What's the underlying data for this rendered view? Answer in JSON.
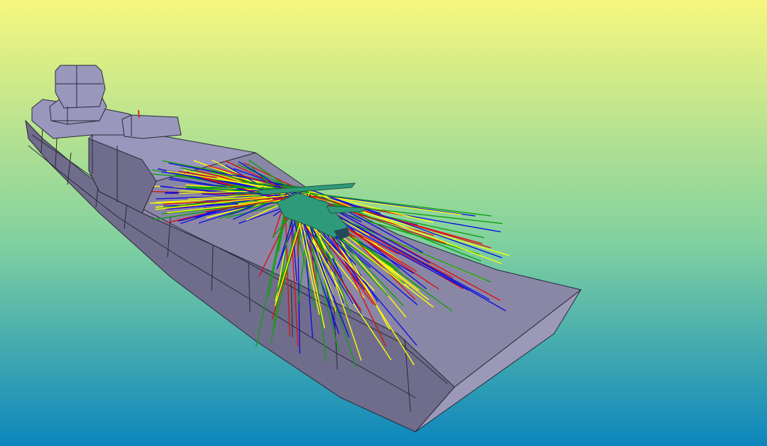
{
  "scene": {
    "background_top": "#f6f77e",
    "background_bottom": "#0c86bd",
    "hull_color": "#8a87a6",
    "hull_light": "#9c99b8",
    "hull_dark": "#6f6c8c",
    "superstructure_color": "#9a97bd",
    "edge_color": "#2a2838",
    "helicopter_color": "#2f9a7a",
    "ray_colors": [
      "#1010e0",
      "#ffff00",
      "#e01010",
      "#10a010"
    ]
  }
}
